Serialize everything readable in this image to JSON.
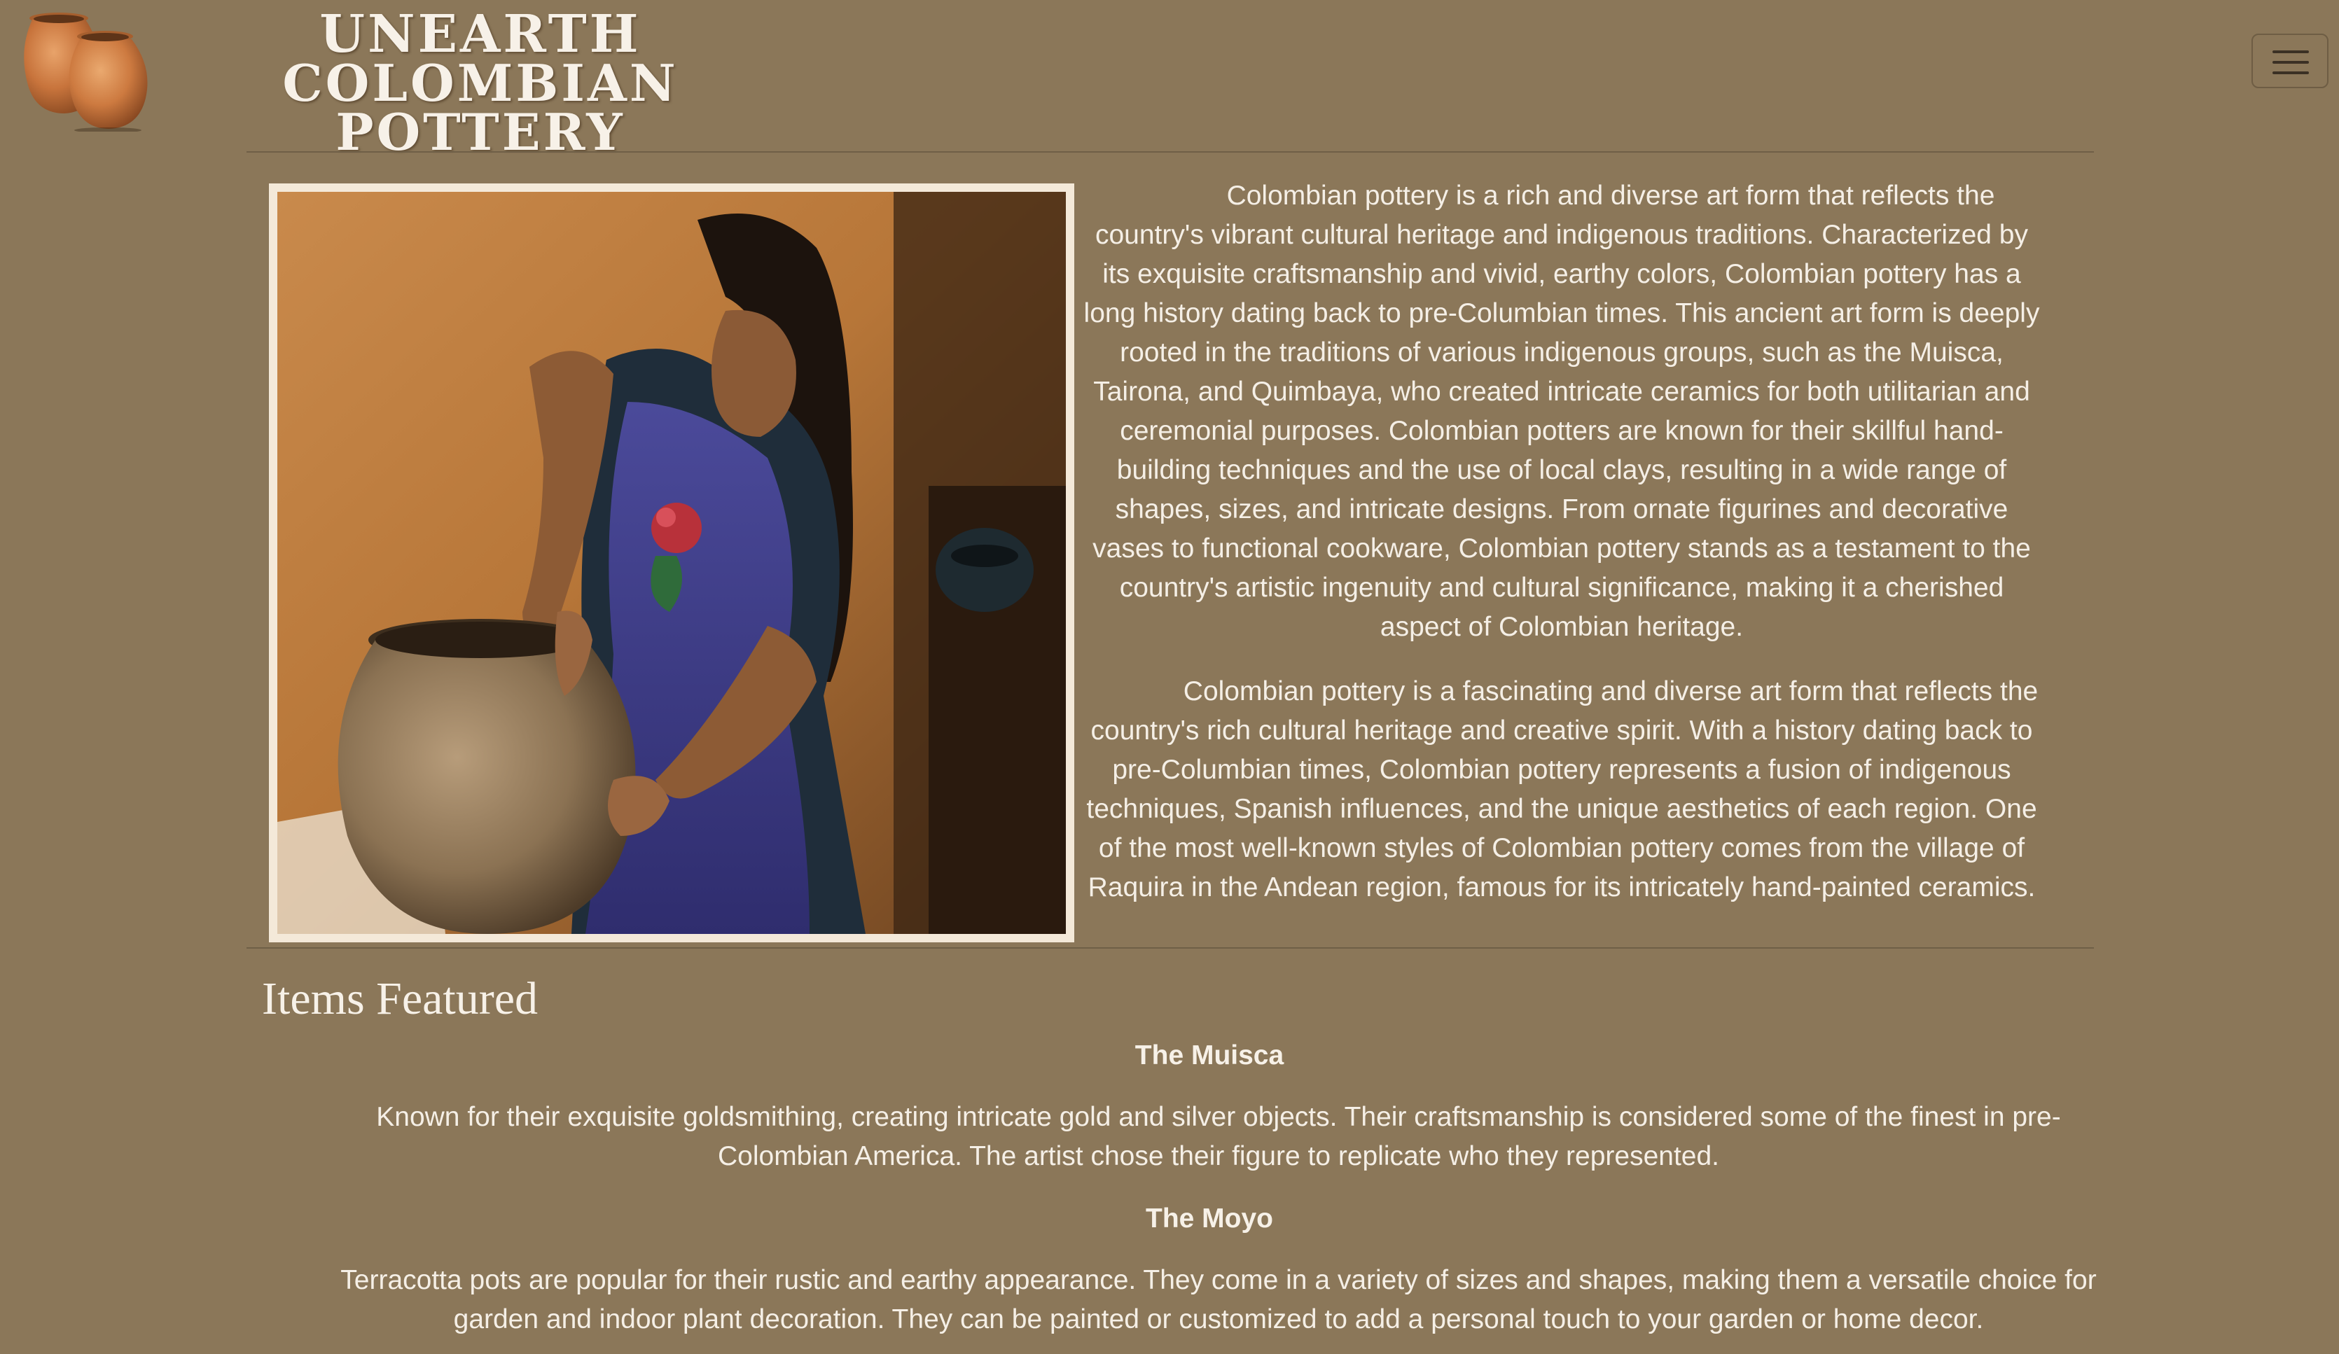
{
  "header": {
    "brand_line1": "UNEARTH",
    "brand_line2": "COLOMBIAN POTTERY",
    "logo_icon": "pottery-vases-logo",
    "menu_icon": "hamburger-menu-icon"
  },
  "intro": {
    "paragraphs": [
      "Colombian pottery is a rich and diverse art form that reflects the country's vibrant cultural heritage and indigenous traditions. Characterized by its exquisite craftsmanship and vivid, earthy colors, Colombian pottery has a long history dating back to pre-Columbian times. This ancient art form is deeply rooted in the traditions of various indigenous groups, such as the Muisca, Tairona, and Quimbaya, who created intricate ceramics for both utilitarian and ceremonial purposes. Colombian potters are known for their skillful hand-building techniques and the use of local clays, resulting in a wide range of shapes, sizes, and intricate designs. From ornate figurines and decorative vases to functional cookware, Colombian pottery stands as a testament to the country's artistic ingenuity and cultural significance, making it a cherished aspect of Colombian heritage.",
      "Colombian pottery is a fascinating and diverse art form that reflects the country's rich cultural heritage and creative spirit. With a history dating back to pre-Columbian times, Colombian pottery represents a fusion of indigenous techniques, Spanish influences, and the unique aesthetics of each region. One of the most well-known styles of Colombian pottery comes from the village of Raquira in the Andean region, famous for its intricately hand-painted ceramics."
    ]
  },
  "featured": {
    "title": "Items Featured",
    "items": [
      {
        "name": "The Muisca",
        "description": "Known for their exquisite goldsmithing, creating intricate gold and silver objects. Their craftsmanship is considered some of the finest in pre-Colombian America. The artist chose their figure to replicate who they represented."
      },
      {
        "name": "The Moyo",
        "description": "Terracotta pots are popular for their rustic and earthy appearance. They come in a variety of sizes and shapes, making them a versatile choice for garden and indoor plant decoration. They can be painted or customized to add a personal touch to your garden or home decor."
      }
    ]
  },
  "colors": {
    "background": "#8b7759",
    "text": "#f5efe6",
    "frame": "#f4e9d9",
    "terracotta": "#c9773c"
  }
}
